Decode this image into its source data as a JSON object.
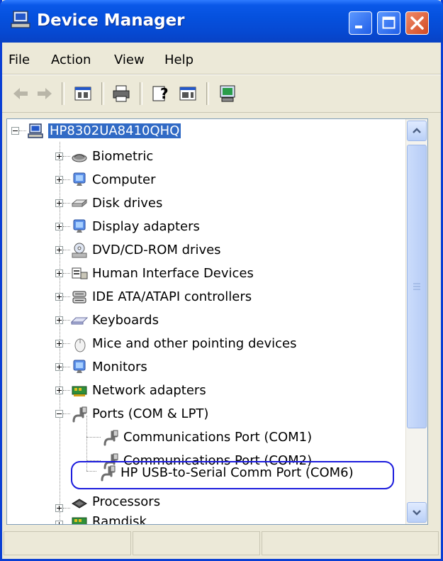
{
  "window": {
    "title": "Device Manager"
  },
  "menu": {
    "file": "File",
    "action": "Action",
    "view": "View",
    "help": "Help"
  },
  "tree": {
    "root": "HP8302UA8410QHQ",
    "categories": [
      {
        "label": "Biometric",
        "icon": "biometric-icon"
      },
      {
        "label": "Computer",
        "icon": "computer-icon"
      },
      {
        "label": "Disk drives",
        "icon": "disk-drive-icon"
      },
      {
        "label": "Display adapters",
        "icon": "display-adapter-icon"
      },
      {
        "label": "DVD/CD-ROM drives",
        "icon": "dvd-drive-icon"
      },
      {
        "label": "Human Interface Devices",
        "icon": "hid-icon"
      },
      {
        "label": "IDE ATA/ATAPI controllers",
        "icon": "ide-controller-icon"
      },
      {
        "label": "Keyboards",
        "icon": "keyboard-icon"
      },
      {
        "label": "Mice and other pointing devices",
        "icon": "mouse-icon"
      },
      {
        "label": "Monitors",
        "icon": "monitor-icon"
      },
      {
        "label": "Network adapters",
        "icon": "network-adapter-icon"
      },
      {
        "label": "Ports (COM & LPT)",
        "icon": "port-icon"
      },
      {
        "label": "Processors",
        "icon": "processor-icon"
      },
      {
        "label": "Ramdisk",
        "icon": "ramdisk-icon"
      }
    ],
    "ports": [
      "Communications Port (COM1)",
      "Communications Port (COM2)",
      "HP USB-to-Serial Comm Port (COM6)"
    ]
  },
  "colors": {
    "titlebar": "#0a58e8",
    "selection": "#316ac5",
    "annotation": "#1b1bdd"
  }
}
